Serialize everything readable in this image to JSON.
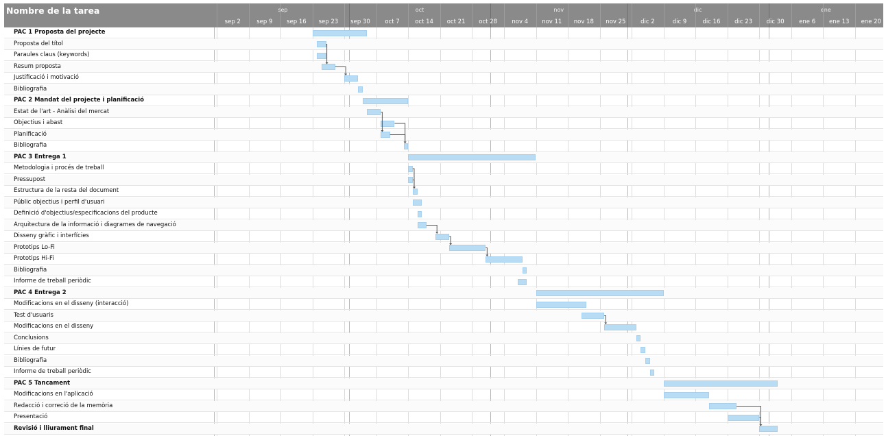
{
  "header": {
    "task_column_title": "Nombre de la tarea",
    "months": [
      "sep",
      "oct",
      "nov",
      "dic",
      "ene"
    ],
    "weeks": [
      "sep 2",
      "sep 9",
      "sep 16",
      "sep 23",
      "sep 30",
      "oct 7",
      "oct 14",
      "oct 21",
      "oct 28",
      "nov 4",
      "nov 11",
      "nov 18",
      "nov 25",
      "dic 2",
      "dic 9",
      "dic 16",
      "dic 23",
      "dic 30",
      "ene 6",
      "ene 13",
      "ene 20"
    ]
  },
  "colors": {
    "header_bg": "#8a8a8a",
    "bar_fill": "#b8dcf4",
    "dependency_line": "#555555"
  },
  "tasks": [
    {
      "name": "PAC 1 Proposta del projecte",
      "summary": true,
      "start": "2019-09-23",
      "end": "2019-10-04"
    },
    {
      "name": "Proposta del títol",
      "summary": false,
      "start": "2019-09-24",
      "end": "2019-09-25"
    },
    {
      "name": "Paraules claus (keywords)",
      "summary": false,
      "start": "2019-09-24",
      "end": "2019-09-25"
    },
    {
      "name": "Resum proposta",
      "summary": false,
      "start": "2019-09-25",
      "end": "2019-09-27"
    },
    {
      "name": "Justificació i motivació",
      "summary": false,
      "start": "2019-09-30",
      "end": "2019-10-02"
    },
    {
      "name": "Bibliografia",
      "summary": false,
      "start": "2019-10-03",
      "end": "2019-10-03"
    },
    {
      "name": "PAC 2 Mandat del projecte i planificació",
      "summary": true,
      "start": "2019-10-04",
      "end": "2019-10-13"
    },
    {
      "name": "Estat de l'art - Anàlisi del mercat",
      "summary": false,
      "start": "2019-10-05",
      "end": "2019-10-07"
    },
    {
      "name": "Objectius i abast",
      "summary": false,
      "start": "2019-10-08",
      "end": "2019-10-10"
    },
    {
      "name": "Planificació",
      "summary": false,
      "start": "2019-10-08",
      "end": "2019-10-09"
    },
    {
      "name": "Bibliografia",
      "summary": false,
      "start": "2019-10-13",
      "end": "2019-10-13"
    },
    {
      "name": "PAC 3 Entrega 1",
      "summary": true,
      "start": "2019-10-14",
      "end": "2019-11-10"
    },
    {
      "name": "Metodologia i procés de treball",
      "summary": false,
      "start": "2019-10-14",
      "end": "2019-10-14"
    },
    {
      "name": "Pressupost",
      "summary": false,
      "start": "2019-10-14",
      "end": "2019-10-14"
    },
    {
      "name": "Estructura de la resta del document",
      "summary": false,
      "start": "2019-10-15",
      "end": "2019-10-15"
    },
    {
      "name": "Públic objectius i perfil d'usuari",
      "summary": false,
      "start": "2019-10-15",
      "end": "2019-10-16"
    },
    {
      "name": "Definició d'objectius/especificacions del producte",
      "summary": false,
      "start": "2019-10-16",
      "end": "2019-10-16"
    },
    {
      "name": "Arquitectura de la informació i diagrames de navegació",
      "summary": false,
      "start": "2019-10-16",
      "end": "2019-10-17"
    },
    {
      "name": "Disseny gràfic i interfícies",
      "summary": false,
      "start": "2019-10-20",
      "end": "2019-10-22"
    },
    {
      "name": "Prototips Lo-Fi",
      "summary": false,
      "start": "2019-10-23",
      "end": "2019-10-30"
    },
    {
      "name": "Prototips Hi-Fi",
      "summary": false,
      "start": "2019-10-31",
      "end": "2019-11-07"
    },
    {
      "name": "Bibliografia",
      "summary": false,
      "start": "2019-11-08",
      "end": "2019-11-08"
    },
    {
      "name": "Informe de treball periòdic",
      "summary": false,
      "start": "2019-11-07",
      "end": "2019-11-08"
    },
    {
      "name": "PAC 4 Entrega 2",
      "summary": true,
      "start": "2019-11-11",
      "end": "2019-12-08"
    },
    {
      "name": "Modificacions en el disseny (interacció)",
      "summary": false,
      "start": "2019-11-11",
      "end": "2019-11-21"
    },
    {
      "name": "Test d'usuaris",
      "summary": false,
      "start": "2019-11-21",
      "end": "2019-11-25"
    },
    {
      "name": "Modificacions en el disseny",
      "summary": false,
      "start": "2019-11-26",
      "end": "2019-12-02"
    },
    {
      "name": "Conclusions",
      "summary": false,
      "start": "2019-12-03",
      "end": "2019-12-03"
    },
    {
      "name": "Línies de futur",
      "summary": false,
      "start": "2019-12-04",
      "end": "2019-12-04"
    },
    {
      "name": "Bibliografia",
      "summary": false,
      "start": "2019-12-05",
      "end": "2019-12-05"
    },
    {
      "name": "Informe de treball periòdic",
      "summary": false,
      "start": "2019-12-06",
      "end": "2019-12-06"
    },
    {
      "name": "PAC 5 Tancament",
      "summary": true,
      "start": "2019-12-09",
      "end": "2020-01-02"
    },
    {
      "name": "Modificacions en l'aplicació",
      "summary": false,
      "start": "2019-12-09",
      "end": "2019-12-18"
    },
    {
      "name": "Redacció i correció de la memòria",
      "summary": false,
      "start": "2019-12-19",
      "end": "2019-12-24"
    },
    {
      "name": "Presentació",
      "summary": false,
      "start": "2019-12-23",
      "end": "2019-12-29"
    },
    {
      "name": "Revisió i lliurament final",
      "summary": true,
      "start": "2019-12-30",
      "end": "2020-01-02"
    }
  ],
  "dependencies": [
    [
      1,
      3
    ],
    [
      3,
      4
    ],
    [
      7,
      9
    ],
    [
      8,
      10
    ],
    [
      9,
      10
    ],
    [
      12,
      14
    ],
    [
      13,
      14
    ],
    [
      17,
      18
    ],
    [
      18,
      19
    ],
    [
      19,
      20
    ],
    [
      25,
      26
    ],
    [
      33,
      35
    ],
    [
      34,
      35
    ]
  ]
}
